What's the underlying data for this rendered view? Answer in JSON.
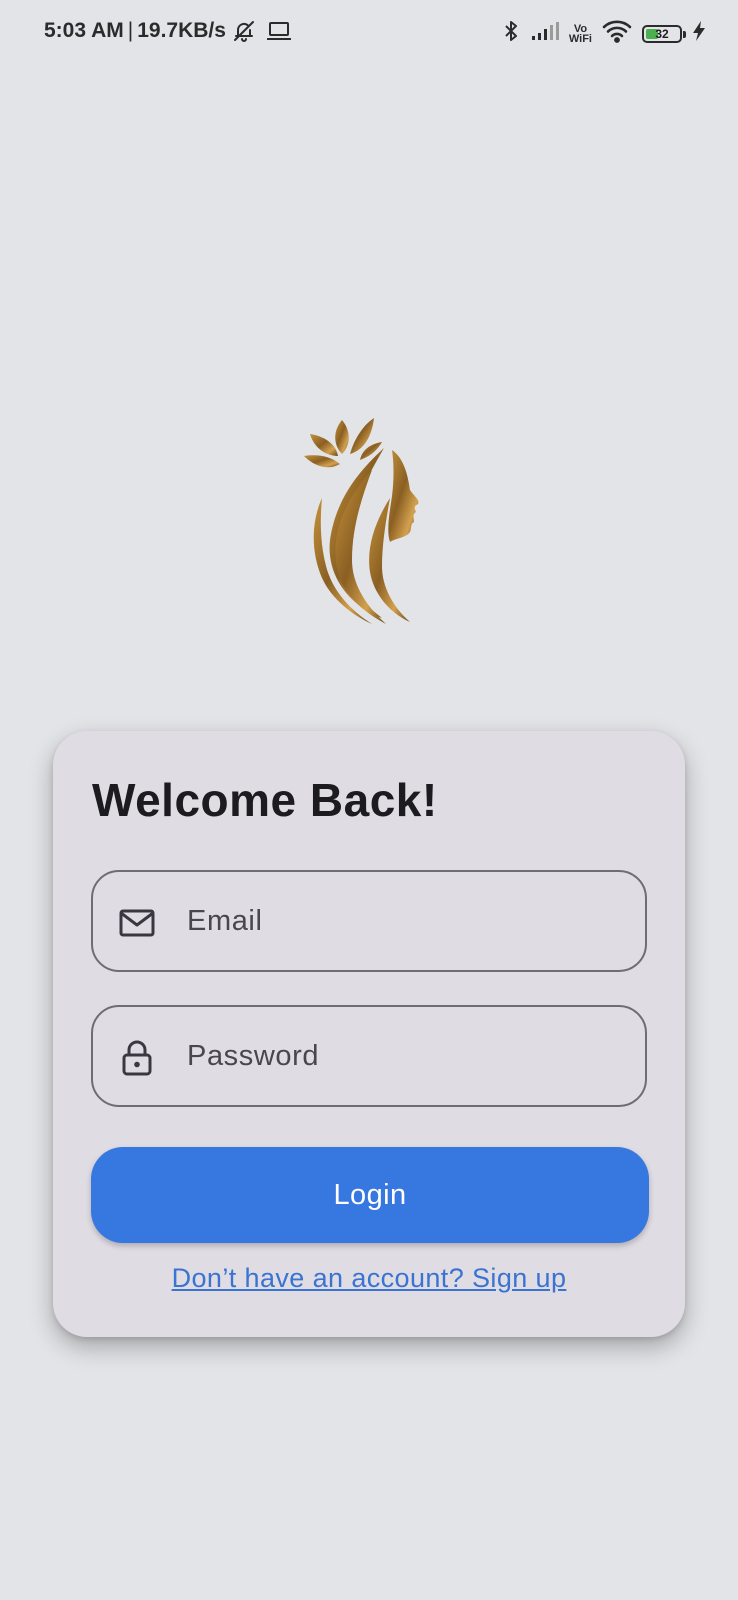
{
  "status_bar": {
    "time": "5:03 AM",
    "network_speed": "19.7KB/s",
    "battery_level": "32",
    "icons": [
      "bell-off-icon",
      "laptop-icon",
      "bluetooth-icon",
      "signal-icon",
      "vowifi-icon",
      "wifi-icon",
      "battery-icon",
      "charging-icon"
    ],
    "vowifi_top": "Vo",
    "vowifi_bottom": "WiFi"
  },
  "logo": {
    "icon": "woman-lotus-logo",
    "colors": [
      "#6b4a18",
      "#c4923c",
      "#8a5f22"
    ]
  },
  "login_card": {
    "title": "Welcome Back!",
    "email": {
      "placeholder": "Email",
      "value": "",
      "icon": "mail-icon"
    },
    "password": {
      "placeholder": "Password",
      "value": "",
      "icon": "lock-icon"
    },
    "login_label": "Login",
    "signup_link": "Don’t have an account? Sign up"
  },
  "colors": {
    "background": "#e3e4e7",
    "card": "#dfdde3",
    "primary": "#3777e0",
    "link": "#3a73d1",
    "outline": "#6f6c73"
  }
}
